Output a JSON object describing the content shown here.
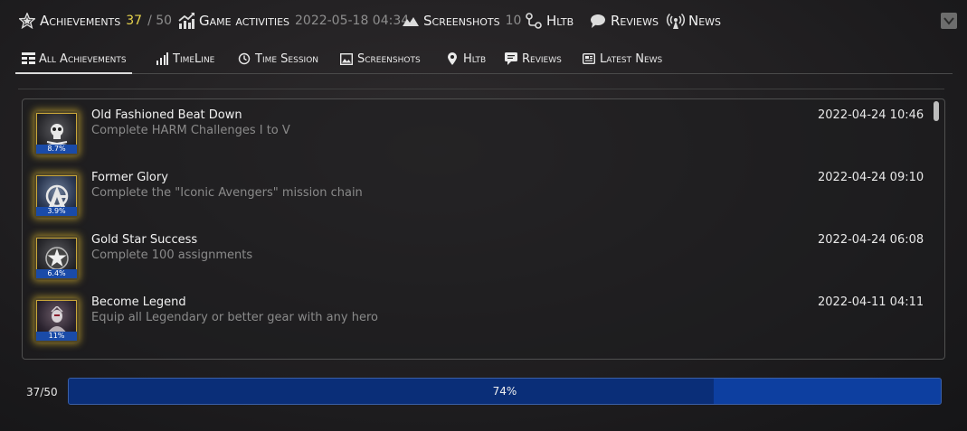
{
  "header": {
    "achievements_label": "Achievements",
    "achievements_unlocked": "37",
    "achievements_total": "/ 50",
    "activities_label": "Game activities",
    "activities_date": "2022-05-18 04:34",
    "screenshots_label": "Screenshots",
    "screenshots_count": "10",
    "hltb_label": "Hltb",
    "reviews_label": "Reviews",
    "news_label": "News"
  },
  "tabs": [
    {
      "label": "All Achievements",
      "icon": "list-icon",
      "active": true
    },
    {
      "label": "TimeLine",
      "icon": "bar-chart-icon",
      "active": false
    },
    {
      "label": "Time Session",
      "icon": "history-icon",
      "active": false
    },
    {
      "label": "Screenshots",
      "icon": "image-icon",
      "active": false
    },
    {
      "label": "Hltb",
      "icon": "map-pin-icon",
      "active": false
    },
    {
      "label": "Reviews",
      "icon": "comment-icon",
      "active": false
    },
    {
      "label": "Latest News",
      "icon": "newspaper-icon",
      "active": false
    }
  ],
  "achievements": [
    {
      "title": "Old Fashioned Beat Down",
      "description": "Complete HARM Challenges I to V",
      "date": "2022-04-24 10:46",
      "percent": "8.7%"
    },
    {
      "title": "Former Glory",
      "description": "Complete the \"Iconic Avengers\" mission chain",
      "date": "2022-04-24 09:10",
      "percent": "3.9%"
    },
    {
      "title": "Gold Star Success",
      "description": "Complete 100 assignments",
      "date": "2022-04-24 06:08",
      "percent": "6.4%"
    },
    {
      "title": "Become Legend",
      "description": "Equip all Legendary or better gear with any hero",
      "date": "2022-04-11 04:11",
      "percent": "11%"
    }
  ],
  "progress": {
    "label": "37/50",
    "percent_text": "74%",
    "fraction": 0.74
  },
  "colors": {
    "accent_yellow": "#e8d44d",
    "progress_blue": "#0d3fa0",
    "progress_fill": "#0a2e78",
    "badge_glow": "#ebc332"
  }
}
